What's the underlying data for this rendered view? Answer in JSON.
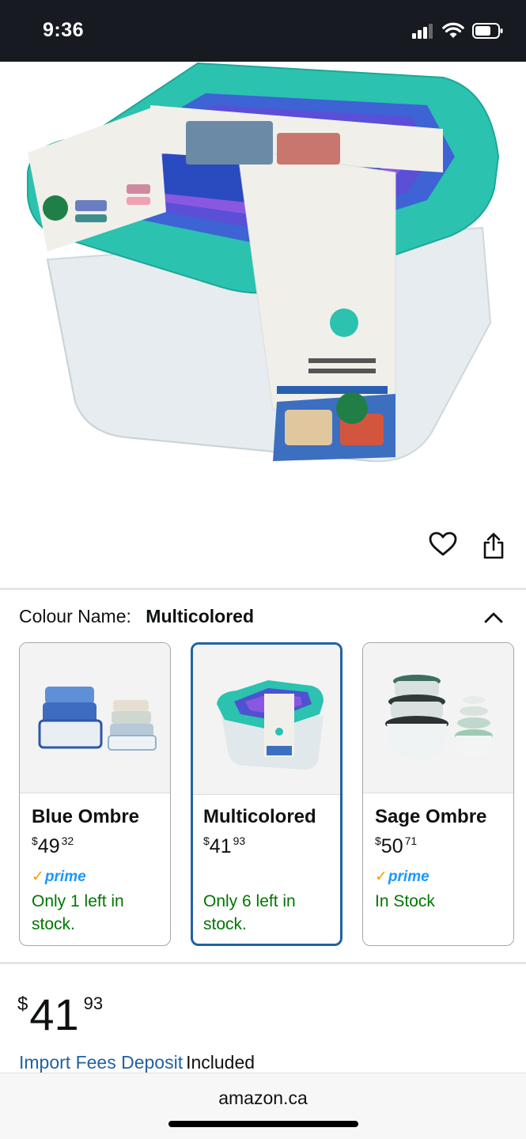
{
  "status_bar": {
    "time": "9:36"
  },
  "colour": {
    "label": "Colour Name:",
    "value": "Multicolored"
  },
  "variants": [
    {
      "name": "Blue Ombre",
      "price_currency": "$",
      "price_dollars": "49",
      "price_cents": "32",
      "prime": "prime",
      "stock": "Only 1 left in stock."
    },
    {
      "name": "Multicolored",
      "price_currency": "$",
      "price_dollars": "41",
      "price_cents": "93",
      "prime": "",
      "stock": "Only 6 left in stock."
    },
    {
      "name": "Sage Ombre",
      "price_currency": "$",
      "price_dollars": "50",
      "price_cents": "71",
      "prime": "prime",
      "stock": "In Stock"
    }
  ],
  "price": {
    "currency": "$",
    "dollars": "41",
    "cents": "93"
  },
  "import_fees": {
    "link": "Import Fees Deposit",
    "text": "Included"
  },
  "browser": {
    "url": "amazon.ca"
  },
  "colors": {
    "link": "#2162a1",
    "stock_green": "#007600",
    "prime_blue": "#1a98ff",
    "selected_border": "#2162a1"
  }
}
